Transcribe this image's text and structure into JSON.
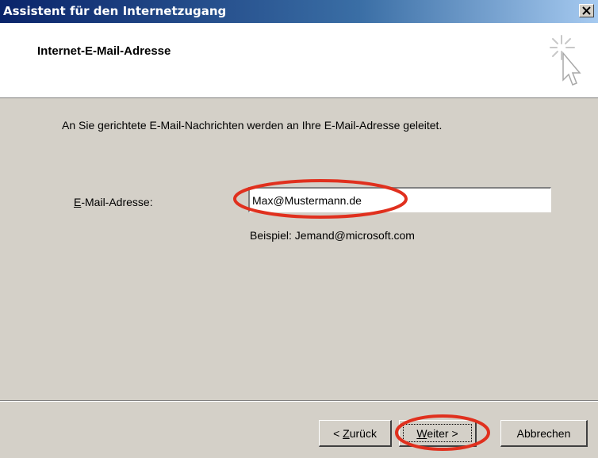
{
  "window": {
    "title": "Assistent für den Internetzugang",
    "close_label": "close"
  },
  "header": {
    "title": "Internet-E-Mail-Adresse",
    "icon": "wizard-cursor-icon"
  },
  "main": {
    "description": "An Sie gerichtete E-Mail-Nachrichten werden an Ihre E-Mail-Adresse geleitet.",
    "email_label_accel": "E",
    "email_label_rest": "-Mail-Adresse:",
    "email_value": "Max@Mustermann.de",
    "example": "Beispiel: Jemand@microsoft.com"
  },
  "footer": {
    "back_prefix": "< ",
    "back_accel": "Z",
    "back_rest": "urück",
    "next_accel": "W",
    "next_rest": "eiter >",
    "cancel_label": "Abbrechen"
  },
  "annotations": {
    "highlight_color": "#e0301e"
  },
  "colors": {
    "title_gradient_start": "#0a246a",
    "title_gradient_end": "#a6caf0",
    "dialog_face": "#d4d0c8"
  }
}
